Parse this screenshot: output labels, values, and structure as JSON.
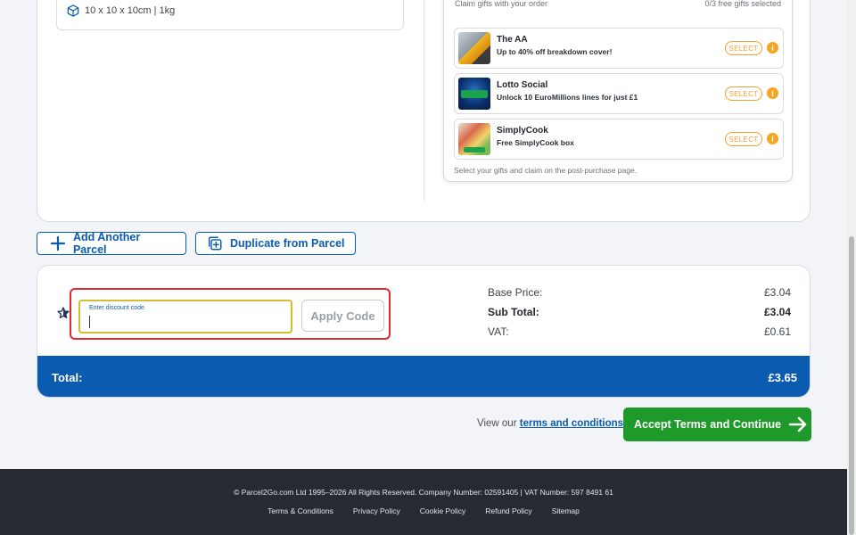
{
  "parcel": {
    "dimensions": "10 x 10 x 10cm  |  1kg"
  },
  "gifts": {
    "header_left": "Claim gifts with your order",
    "header_right": "0/3 free gifts selected",
    "items": [
      {
        "name": "The AA",
        "desc": "Up to 40% off breakdown cover!",
        "select_label": "SELECT",
        "info": "i"
      },
      {
        "name": "Lotto Social",
        "desc": "Unlock 10 EuroMillions lines for just £1",
        "select_label": "SELECT",
        "info": "i"
      },
      {
        "name": "SimplyCook",
        "desc": "Free SimplyCook box",
        "select_label": "SELECT",
        "info": "i"
      }
    ],
    "footer": "Select your gifts and claim on the post-purchase page."
  },
  "actions": {
    "add_parcel": "Add Another Parcel",
    "duplicate_parcel": "Duplicate from Parcel"
  },
  "discount": {
    "placeholder": "Enter discount code",
    "apply_label": "Apply Code"
  },
  "pricing": {
    "base_label": "Base Price:",
    "base_value": "£3.04",
    "subtotal_label": "Sub Total:",
    "subtotal_value": "£3.04",
    "vat_label": "VAT:",
    "vat_value": "£0.61",
    "total_label": "Total:",
    "total_value": "£3.65"
  },
  "terms": {
    "prefix": "View our",
    "link": "terms and conditions",
    "accept_label": "Accept Terms and Continue"
  },
  "footer": {
    "copyright": "© Parcel2Go.com Ltd 1995–2026 All Rights Reserved. Company Number: 02591405 | VAT Number: 597 8491 61",
    "links": [
      "Terms & Conditions",
      "Privacy Policy",
      "Cookie Policy",
      "Refund Policy",
      "Sitemap"
    ]
  },
  "colors": {
    "brand_blue": "#0b5cb0",
    "accept_green": "#1e9a2a",
    "gift_orange": "#f2a12a",
    "highlight_red": "#e3282f"
  }
}
